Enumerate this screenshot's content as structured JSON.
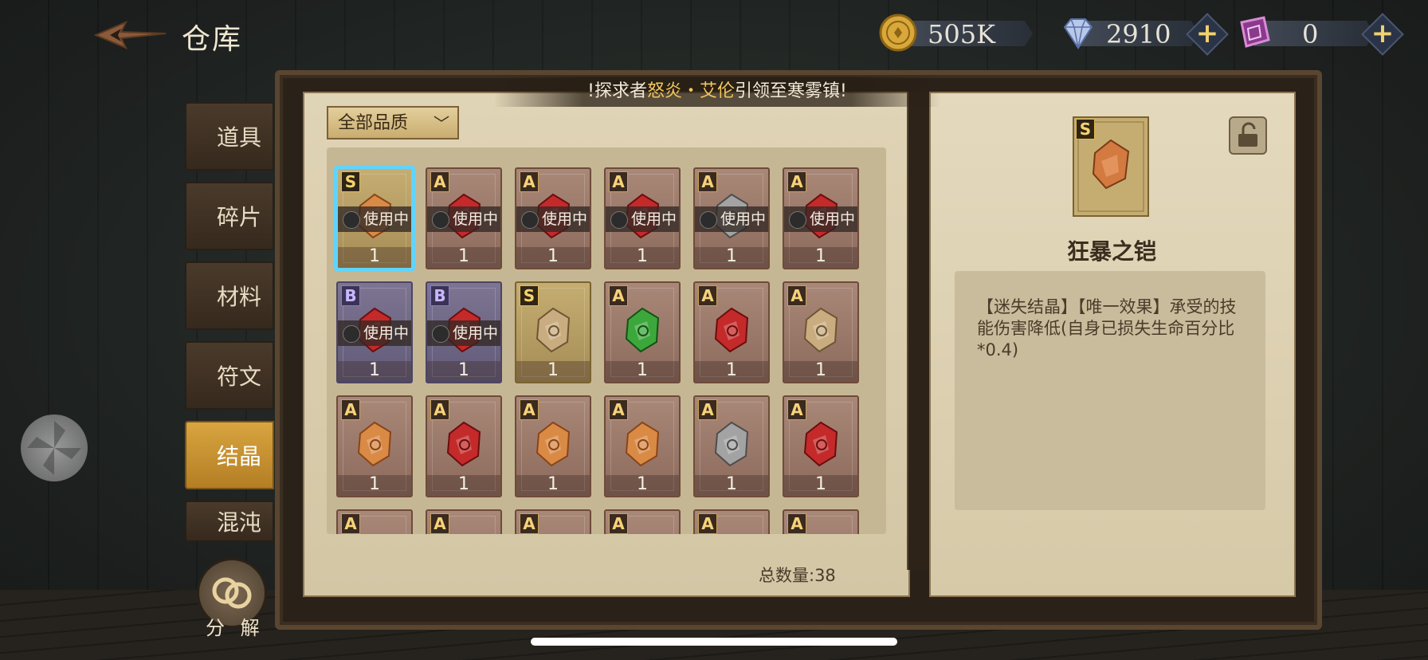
{
  "header": {
    "title": "仓库",
    "currencies": [
      {
        "icon": "gold-coin-icon",
        "value": "505K"
      },
      {
        "icon": "diamond-icon",
        "value": "2910"
      },
      {
        "icon": "purple-crystal-icon",
        "value": "0"
      }
    ],
    "plus_label": "+"
  },
  "banner": {
    "part1": "!探求者",
    "highlight": "怒炎・艾伦",
    "part2": "引领至寒雾镇!"
  },
  "sidebar": {
    "tabs": [
      {
        "label": "道具",
        "active": false
      },
      {
        "label": "碎片",
        "active": false
      },
      {
        "label": "材料",
        "active": false
      },
      {
        "label": "符文",
        "active": false
      },
      {
        "label": "结晶",
        "active": true
      },
      {
        "label": "混沌",
        "active": false
      }
    ],
    "decompose_label": "分 解"
  },
  "filter": {
    "label": "全部品质",
    "chevron": "﹀"
  },
  "colors": {
    "accent_selected": "#5fd4ff",
    "tab_active": "#d8a540",
    "highlight_text": "#f2c65c"
  },
  "items": [
    {
      "rank": "S",
      "gem": "orange",
      "in_use": "使用中",
      "count": "1",
      "selected": true
    },
    {
      "rank": "A",
      "gem": "red",
      "in_use": "使用中",
      "count": "1"
    },
    {
      "rank": "A",
      "gem": "red",
      "in_use": "使用中",
      "count": "1"
    },
    {
      "rank": "A",
      "gem": "red",
      "in_use": "使用中",
      "count": "1"
    },
    {
      "rank": "A",
      "gem": "gray",
      "in_use": "使用中",
      "count": "1"
    },
    {
      "rank": "A",
      "gem": "red",
      "in_use": "使用中",
      "count": "1"
    },
    {
      "rank": "B",
      "gem": "red",
      "in_use": "使用中",
      "count": "1"
    },
    {
      "rank": "B",
      "gem": "red",
      "in_use": "使用中",
      "count": "1"
    },
    {
      "rank": "S",
      "gem": "tan",
      "count": "1"
    },
    {
      "rank": "A",
      "gem": "green",
      "count": "1"
    },
    {
      "rank": "A",
      "gem": "red",
      "count": "1"
    },
    {
      "rank": "A",
      "gem": "tan",
      "count": "1"
    },
    {
      "rank": "A",
      "gem": "orange",
      "count": "1"
    },
    {
      "rank": "A",
      "gem": "red",
      "count": "1"
    },
    {
      "rank": "A",
      "gem": "orange",
      "count": "1"
    },
    {
      "rank": "A",
      "gem": "orange",
      "count": "1"
    },
    {
      "rank": "A",
      "gem": "gray",
      "count": "1"
    },
    {
      "rank": "A",
      "gem": "red",
      "count": "1"
    },
    {
      "rank": "A",
      "gem": "red",
      "count": ""
    },
    {
      "rank": "A",
      "gem": "red",
      "count": ""
    },
    {
      "rank": "A",
      "gem": "green",
      "count": ""
    },
    {
      "rank": "A",
      "gem": "orange",
      "count": ""
    },
    {
      "rank": "A",
      "gem": "orange",
      "count": ""
    },
    {
      "rank": "A",
      "gem": "gray",
      "count": ""
    }
  ],
  "total": "总数量:38",
  "detail": {
    "rank": "S",
    "name": "狂暴之铠",
    "description": "【迷失结晶】【唯一效果】承受的技能伤害降低(自身已损失生命百分比*0.4)"
  }
}
